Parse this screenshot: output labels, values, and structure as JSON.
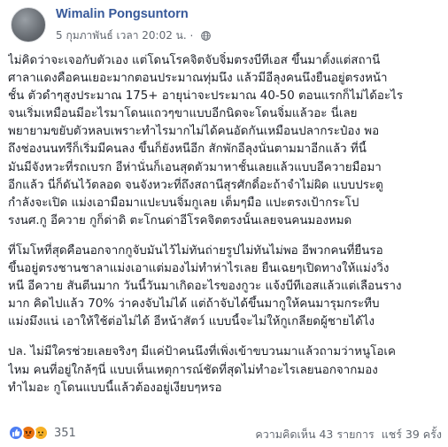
{
  "post": {
    "author": "Wimalin Pongsuntorn",
    "timestamp": "5 กุมภาพันธ์ เวลา 20:02 น.",
    "privacy_separator": "·",
    "paragraphs": [
      [
        "ไม่คิดว่าจะเจอกับตัวเอง แต่โดนโรคจิตจับจิ๋มตรงบีทีเอส ขึ้นมาตั้งแต่สถานี",
        "ศาลาแดงคือคนเยอะมากตอนประมาณทุ่มนึง แล้วมีอีลุงคนนึงยืนอยู่ตรงหน้า",
        "ชั้น ตัวดำๆสูงประมาณ 175+ อายุน่าจะประมาณ 40-50 ตอนแรกก็ไม่ได้อะไร",
        "จนเริ่มเหมือนมีอะไรมาโดนแถวๆขาแบบอีกนิดจะโดนจิ๋มแล้วอะ นี่เลย",
        "พยายามขยับตัวหลบเพราะทำไรมากไม่ได้คนอัดกันเหมือนปลากระป๋อง พอ",
        "ถึงช่องนนทรีก็เริ่มมีคนลง ขึ้นก็ยังหนีอีก สักพักอีลุงนั่นตามมาอีกแล้ว ที่นี้",
        "มันมีจังหวะที่รถเบรก อีห่านั่นก็เอนสุดตัวมาหาชั้นเลยแล้วแบบอีควายมือมา",
        "อีกแล้ว นี่ก็ดันไว้ตลอด จนจังหวะที่ถึงสถานีสุรศักดิ์อะถ้าจำไม่ผิด แบบประตู",
        "กำลังจะเปิด แม่งเอามือมาแปะบนจิ๋มกูเลย เต็มๆมือ แปะตรงเป้ากระโป",
        "รงนศ.กู อีควาย กูก็ด่าดิ ตะโกนด่าอีโรคจิตตรงนั้นเลยจนคนมองหมด"
      ],
      [
        "ที่โมโหที่สุดคือนอกจากกูจับมันไว้ไม่ทันถ่ายรูปไม่ทันไม่พอ อีพวกคนที่ยืนรอ",
        "ขึ้นอยู่ตรงชานชาลาแม่งเอาแต่มองไม่ทำห่าไรเลย ยืนเฉยๆเปิดทางให้แม่งวิ่ง",
        "หนี อีควาย สันตีนมาก วันนี้วันมาเกิดอะไรของกูวะ แจ้งบีทีเอสแล้วแต่เลือนราง",
        "มาก คิดไปแล้ว 70% ว่าคงจับไม่ได้ แต่ถ้าจับได้ขึ้นมากูให้คนมารุมกระทืบ",
        "แม่งมึงแน่ เอาให้ใช้ต่อไม่ได้ อีหน้าสัตว์ แบบนี้จะไม่ให้กูเกลียดผู้ชายได้ไง"
      ],
      [
        "ปล. ไม่มีใครช่วยเลยจริงๆ มีแค่ป้าคนนึงที่เพิ่งเข้าขบวนมาแล้วถามว่าหนูโอเค",
        "ไหม คนที่อยู่ใกล้ๆนี่ แบบเห็นเหตุการณ์ชัดที่สุดไม่ทำอะไรเลยนอกจากมอง",
        "ทำไมอะ กูโดนแบบนี้แล้วต้องอยู่เงียบๆหรอ"
      ]
    ]
  },
  "reactions": {
    "types": [
      "like",
      "angry",
      "sad"
    ],
    "count": "351",
    "colors": {
      "like": "#4d7ef3",
      "angry": "#e9710f",
      "sad": "#f7b125"
    }
  },
  "stats": {
    "comments": "ความคิดเห็น 43 รายการ",
    "shares": "แชร์ 39 ครั้ง"
  },
  "icons": {
    "privacy": "globe-icon"
  },
  "colors": {
    "author_link": "#365899",
    "meta_text": "#616770",
    "body_text": "#1d2129"
  }
}
